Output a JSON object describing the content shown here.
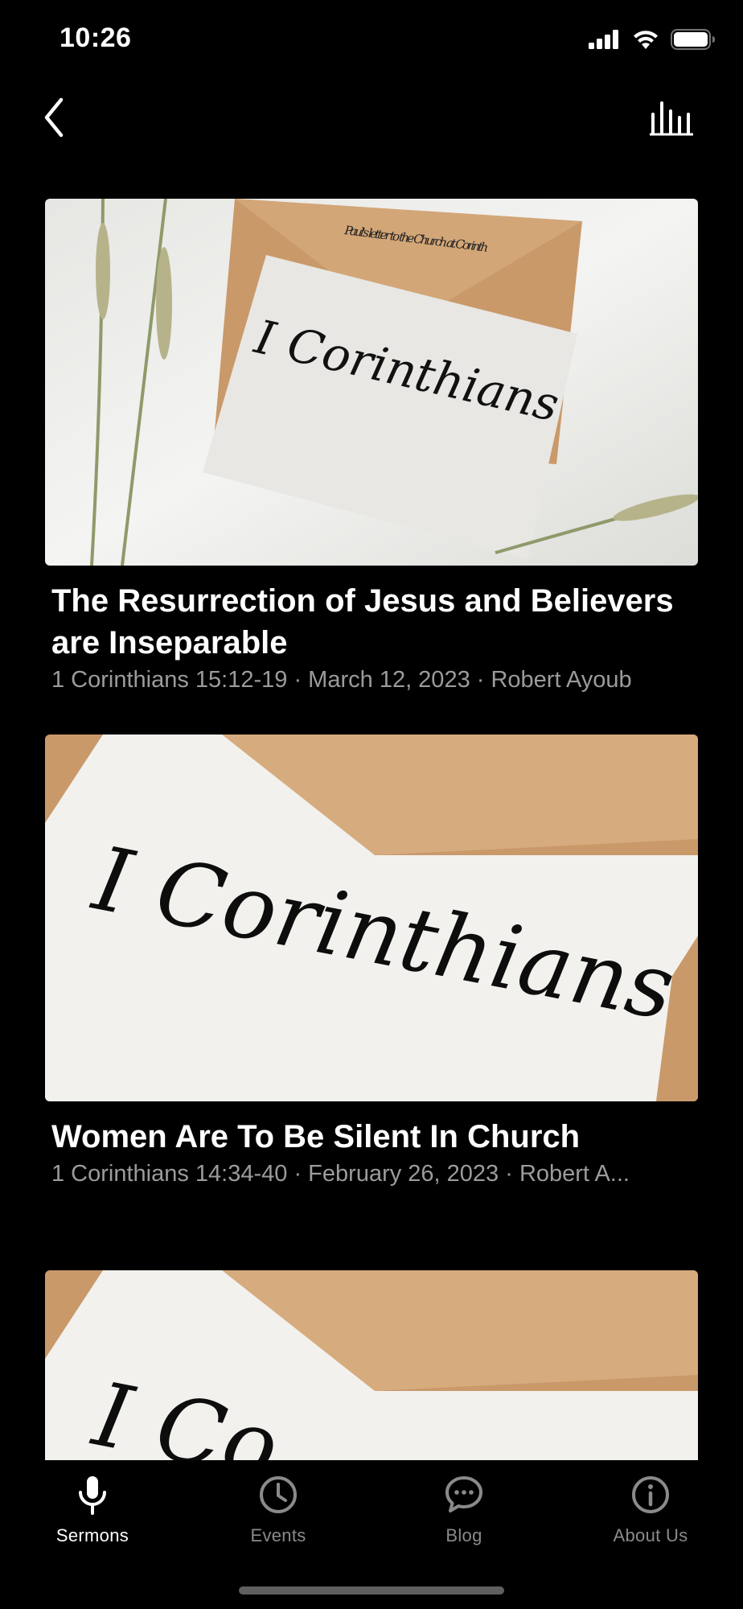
{
  "status_bar": {
    "time": "10:26"
  },
  "sermons": [
    {
      "title": "The Resurrection of Jesus and Believers are Inseparable",
      "meta": "1 Corinthians 15:12-19 · March 12, 2023 · Robert Ayoub",
      "image_text": "I Corinthians",
      "envelope_text": "Paul's letter to the Church at Corinth"
    },
    {
      "title": "Women Are To Be Silent In Church",
      "meta": "1 Corinthians 14:34-40 · February 26, 2023 · Robert A...",
      "image_text": "I Corinthians"
    },
    {
      "image_text": "I Co"
    }
  ],
  "tabs": [
    {
      "label": "Sermons",
      "icon": "microphone-icon",
      "active": true
    },
    {
      "label": "Events",
      "icon": "clock-icon",
      "active": false
    },
    {
      "label": "Blog",
      "icon": "chat-bubble-icon",
      "active": false
    },
    {
      "label": "About Us",
      "icon": "info-icon",
      "active": false
    }
  ],
  "colors": {
    "background": "#000000",
    "active_tab": "#ffffff",
    "inactive_tab": "#8a8a8a",
    "meta_text": "#9b9b9b",
    "envelope": "#c9996a",
    "paper": "#f2f1ed"
  }
}
